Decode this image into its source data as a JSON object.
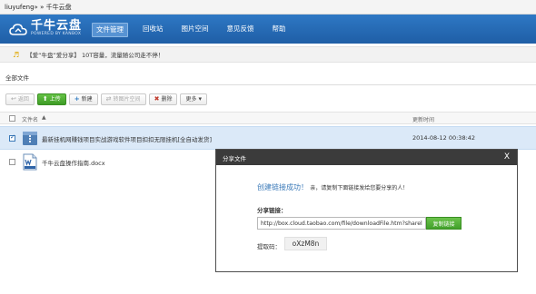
{
  "window": {
    "title": "liuyufeng» » 千牛云盘"
  },
  "brand": {
    "name": "千牛云盘",
    "tagline": "POWERED BY KANBOX",
    "color": "#1f5ea6"
  },
  "nav": {
    "items": [
      {
        "label": "文件管理",
        "active": true
      },
      {
        "label": "回收站"
      },
      {
        "label": "图片空间"
      },
      {
        "label": "意见反馈"
      },
      {
        "label": "帮助"
      }
    ]
  },
  "announcement": {
    "icon": "speaker-icon",
    "text": "【爱“牛盘”爱分享】 10T容量，流量随公司走不停！"
  },
  "section": {
    "title": "全部文件"
  },
  "toolbar": {
    "back": "返回",
    "upload": "上传",
    "create": "新建",
    "to_image_space": "转图片空间",
    "delete": "删除",
    "more": "更多"
  },
  "table": {
    "col_name": "文件名",
    "col_time": "更新时间",
    "rows": [
      {
        "name": "最新挂机网赚钱项目实战游戏软件项目扣扣无限挂机[全自动发货]",
        "time": "2014-08-12 00:38:42",
        "selected": true,
        "icon": "folder-zip-icon"
      },
      {
        "name": "千牛云盘操作指南.docx",
        "time": "",
        "selected": false,
        "icon": "docx-file-icon"
      }
    ]
  },
  "modal": {
    "title": "分享文件",
    "close": "X",
    "success_main": "创建链接成功！",
    "success_sub": "亲，请复制下面链接发给您要分享的人！",
    "share_label": "分享链接：",
    "link_value": "http://box.cloud.taobao.com/file/downloadFile.htm?sharel",
    "copy_label": "复制链接",
    "code_label": "提取码：",
    "code_value": "oXzM8n"
  }
}
